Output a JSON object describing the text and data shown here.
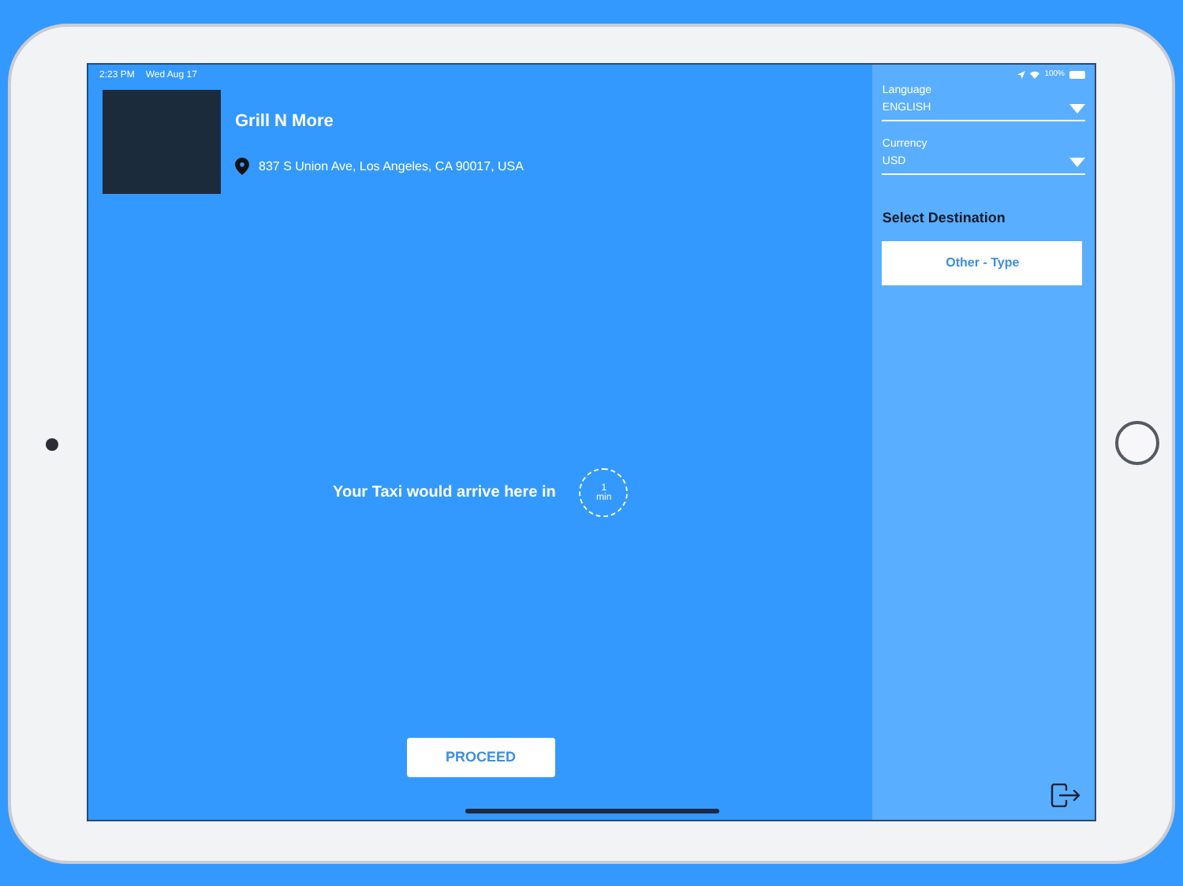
{
  "status_bar": {
    "time": "2:23 PM",
    "date": "Wed Aug 17",
    "battery": "100%"
  },
  "venue": {
    "name": "Grill N More",
    "address": "837 S Union Ave, Los Angeles, CA 90017, USA"
  },
  "eta": {
    "text": "Your Taxi would arrive here in",
    "value": "1",
    "unit": "min"
  },
  "proceed_button": "PROCEED",
  "settings": [
    {
      "label": "Language",
      "value": "ENGLISH"
    },
    {
      "label": "Currency",
      "value": "USD"
    }
  ],
  "destination": {
    "heading": "Select Destination",
    "options": [
      "Other - Type"
    ]
  }
}
